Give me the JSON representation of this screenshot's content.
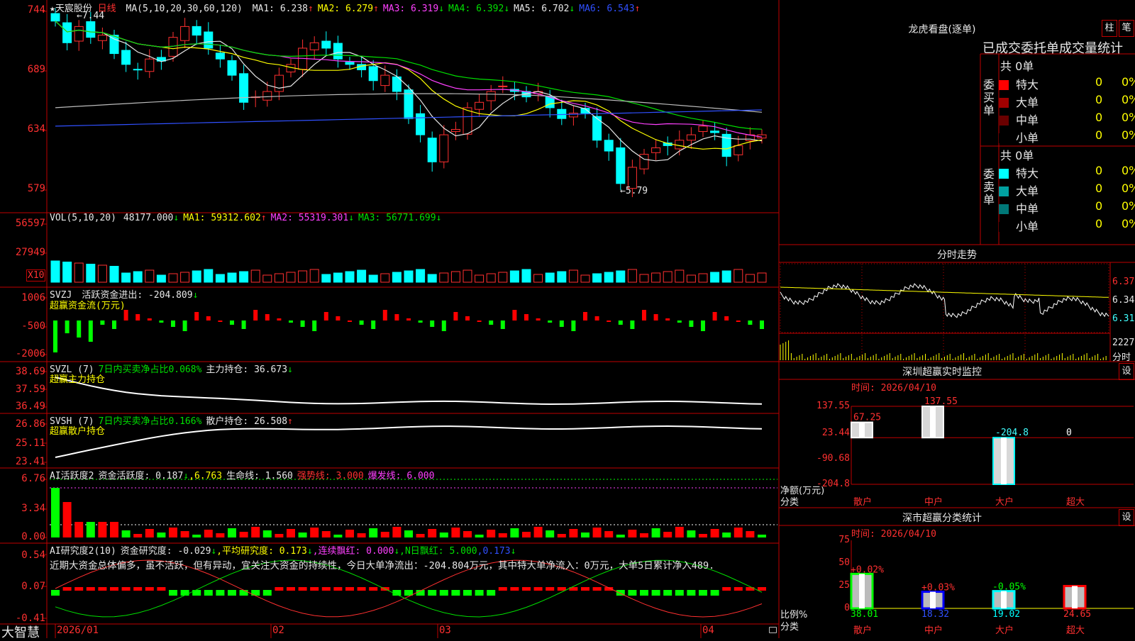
{
  "main": {
    "stock_name": "★天宸股份",
    "period": "日线",
    "ma_header": "MA(5,10,20,30,60,120)",
    "ma": [
      {
        "label": "MA1:",
        "value": "6.238",
        "arrow": "↑",
        "color": "#e8e8e8"
      },
      {
        "label": "MA2:",
        "value": "6.279",
        "arrow": "↑",
        "color": "#ffff00"
      },
      {
        "label": "MA3:",
        "value": "6.319",
        "arrow": "↓",
        "color": "#ff40ff"
      },
      {
        "label": "MA4:",
        "value": "6.392",
        "arrow": "↓",
        "color": "#00e000"
      },
      {
        "label": "MA5:",
        "value": "6.702",
        "arrow": "↓",
        "color": "#e8e8e8"
      },
      {
        "label": "MA6:",
        "value": "6.543",
        "arrow": "↑",
        "color": "#3050ff"
      }
    ],
    "yaxis": [
      "744",
      "689",
      "634",
      "579"
    ],
    "high_note": "←7.44",
    "low_note": "←5.79"
  },
  "vol": {
    "header": "VOL(5,10,20)",
    "value": "48177.000",
    "value_arrow": "↓",
    "ma1": "MA1: 59312.602",
    "ma1_arrow": "↑",
    "ma2": "MA2: 55319.301",
    "ma2_arrow": "↓",
    "ma3": "MA3: 56771.699",
    "ma3_arrow": "↓",
    "yaxis": [
      "56597",
      "27949"
    ],
    "unit": "X10"
  },
  "svzj": {
    "header": "SVZJ",
    "label": "活跃资金进出: -204.809",
    "arrow": "↓",
    "subtitle": "超赢资金流(万元)",
    "yaxis": [
      "1006",
      "-500",
      "-2006"
    ]
  },
  "svzl": {
    "header": "SVZL (7)",
    "label1": "7日内买卖净占比0.068%",
    "label2": "主力持仓: 36.673",
    "arrow": "↓",
    "subtitle": "超赢主力持仓",
    "yaxis": [
      "38.69",
      "37.59",
      "36.49"
    ]
  },
  "svsh": {
    "header": "SVSH (7)",
    "label1": "7日内买卖净占比0.166%",
    "label2": "散户持仓: 26.508",
    "arrow": "↑",
    "subtitle": "超赢散户持仓",
    "yaxis": [
      "26.86",
      "25.11",
      "23.41"
    ]
  },
  "ai1": {
    "header": "AI活跃度2",
    "l1": "资金活跃度: 0.187",
    "l1a": "↓",
    "l2": "6.763",
    "l3": "生命线: 1.560",
    "l4": "强势线: 3.000",
    "l5": "爆发线: 6.000",
    "yaxis": [
      "6.76",
      "3.34",
      "0.00"
    ]
  },
  "ai2": {
    "header": "AI研究度2(10)",
    "l1": "资金研究度: -0.029",
    "l1a": "↓",
    "l2": "平均研究度: 0.173",
    "l2a": "↓",
    "l3": "连续飘红: 0.000",
    "l3a": "↓",
    "l4": "N日飘红: 5.000",
    "l5": "0.173",
    "l5a": "↓",
    "comment": "近期大资金总体偏多，虽不活跃，但有异动，宜关注大资金的持续性，今日大单净流出：-204.804万元，其中特大单净流入：0万元，大单5日累计净入489.",
    "yaxis": [
      "0.54",
      "0.07",
      "-0.41"
    ]
  },
  "footer": {
    "brand": "大智慧",
    "dates": [
      "2026/01",
      "02",
      "03",
      "04"
    ]
  },
  "longhu": {
    "title": "龙虎看盘(逐单)",
    "btn1": "柱",
    "btn2": "笔",
    "subtitle": "已成交委托单成交量统计",
    "buy_label": "委买单",
    "sell_label": "委卖单",
    "buy_total": "共 0单",
    "sell_total": "共 0单",
    "buy_rows": [
      {
        "label": "特大",
        "count": "0",
        "pct": "0%",
        "color": "#ff0000"
      },
      {
        "label": "大单",
        "count": "0",
        "pct": "0%",
        "color": "#a00000"
      },
      {
        "label": "中单",
        "count": "0",
        "pct": "0%",
        "color": "#6a0000"
      },
      {
        "label": "小单",
        "count": "0",
        "pct": "0%",
        "color": "#000000"
      }
    ],
    "sell_rows": [
      {
        "label": "特大",
        "count": "0",
        "pct": "0%",
        "color": "#00ffff"
      },
      {
        "label": "大单",
        "count": "0",
        "pct": "0%",
        "color": "#00a0a0"
      },
      {
        "label": "中单",
        "count": "0",
        "pct": "0%",
        "color": "#007878"
      },
      {
        "label": "小单",
        "count": "0",
        "pct": "0%",
        "color": "#000000"
      }
    ]
  },
  "intraday": {
    "title": "分时走势",
    "yaxis": [
      "6.37",
      "6.34",
      "6.31"
    ],
    "vol_label": "2227",
    "vol_unit": "分时"
  },
  "monitor": {
    "title": "深圳超赢实时监控",
    "btn": "设",
    "time": "时间: 2026/04/10",
    "yaxis": [
      "137.55",
      "23.44",
      "0",
      "-90.68",
      "-204.8"
    ],
    "ylabel": "净额(万元)",
    "xlabel": "分类",
    "categories": [
      "散户",
      "中户",
      "大户",
      "超大"
    ]
  },
  "classify": {
    "title": "深市超赢分类统计",
    "btn": "设",
    "time": "时间: 2026/04/10",
    "yaxis": [
      "75",
      "50",
      "25",
      "0"
    ],
    "ylabel": "比例%",
    "xlabel": "分类",
    "categories": [
      "散户",
      "中户",
      "大户",
      "超大"
    ]
  },
  "chart_data": [
    {
      "type": "bar",
      "title": "深圳超赢实时监控",
      "categories": [
        "散户",
        "中户",
        "大户",
        "超大"
      ],
      "values": [
        67.25,
        137.55,
        -204.8,
        0
      ],
      "value_labels": [
        "67.25",
        "137.55",
        "-204.8",
        "0"
      ],
      "ylabel": "净额(万元)",
      "ylim": [
        -204.8,
        137.55
      ]
    },
    {
      "type": "bar",
      "title": "深市超赢分类统计",
      "categories": [
        "散户",
        "中户",
        "大户",
        "超大"
      ],
      "values": [
        38.01,
        18.32,
        19.02,
        24.65
      ],
      "value_labels": [
        "38.01",
        "18.32",
        "19.02",
        "24.65"
      ],
      "change_labels": [
        "+0.02%",
        "+0.03%",
        "-0.05%",
        ""
      ],
      "ylabel": "比例%",
      "ylim": [
        0,
        75
      ]
    }
  ]
}
